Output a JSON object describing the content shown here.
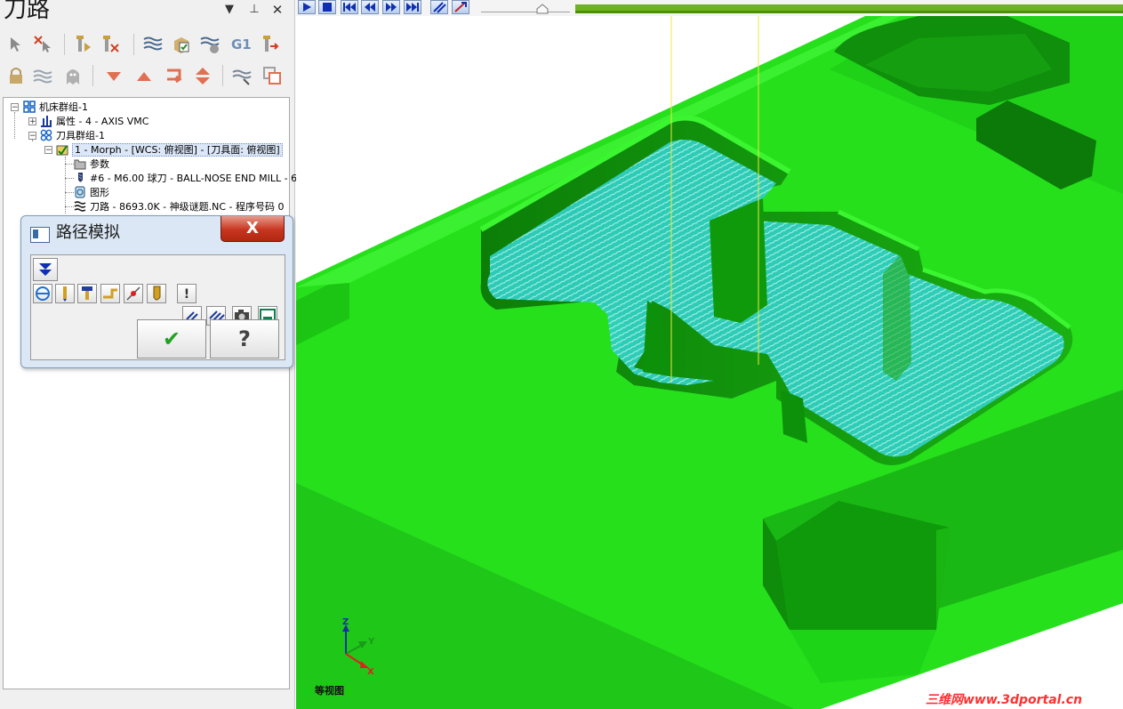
{
  "panel": {
    "title": "刀路",
    "header_icons": [
      "dropdown-arrow-icon",
      "pin-icon",
      "close-icon"
    ]
  },
  "toolbar_row1": [
    "select-all-icon",
    "deselect-icon",
    "regen-icon",
    "regen-dirty-icon",
    "toolpath-stack-icon",
    "verify-icon",
    "backplot-icon",
    "post-g1-icon",
    "export-icon"
  ],
  "toolbar_row2": [
    "lock-icon",
    "toggle-display-icon",
    "ghost-icon",
    "move-down-icon",
    "move-up-icon",
    "insert-icon",
    "expand-icon",
    "toolpath-filter-icon",
    "copy-icon"
  ],
  "toolbar_g1_text": "G1",
  "tree": {
    "machine_group": "机床群组-1",
    "properties": "属性 - 4 - AXIS VMC",
    "toolpath_group": "刀具群组-1",
    "operation": "1 - Morph - [WCS: 俯视图] - [刀具面: 俯视图]",
    "parameters": "参数",
    "tool": "#6 - M6.00 球刀 - BALL-NOSE END MILL - 6",
    "geometry": "图形",
    "toolpath": "刀路 - 8693.0K - 神级谜题.NC - 程序号码 0"
  },
  "dialog": {
    "title": "路径模拟",
    "close_label": "X",
    "buttons": [
      "expand-icon",
      "color-cycle-icon",
      "display-tool-icon",
      "display-holder-icon",
      "rapid-icon",
      "endpoints-icon",
      "shade-tool-icon",
      "info-icon",
      "step-back-icon",
      "step-forward-icon",
      "camera-icon",
      "save-icon"
    ],
    "ok_label": "✔",
    "help_label": "?"
  },
  "viewport": {
    "playback_buttons": [
      "play-icon",
      "stop-icon",
      "start-icon",
      "step-back-icon",
      "step-forward-icon",
      "end-icon",
      "trace-icon",
      "run-icon"
    ],
    "progress_fraction": 1.0,
    "view_name": "等视图",
    "axis_labels": {
      "z": "Z",
      "y": "Y",
      "x": "X"
    },
    "colors": {
      "part": "#22e01a",
      "part_dark": "#0f8f0a",
      "toolpath": "#3fe8d8",
      "axis_x": "#e02020",
      "axis_y": "#1a9a1a",
      "axis_z": "#1a2fa0"
    },
    "watermark": "三维网www.3dportal.cn"
  }
}
